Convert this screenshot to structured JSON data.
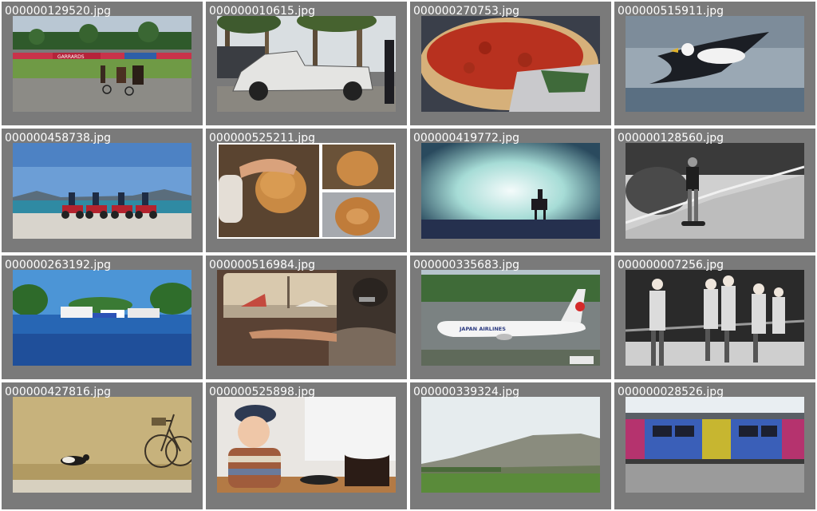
{
  "gallery": {
    "tiles": [
      {
        "filename": "000000129520.jpg",
        "scene": "harness-racing"
      },
      {
        "filename": "000000010615.jpg",
        "scene": "pickup-truck-palms"
      },
      {
        "filename": "000000270753.jpg",
        "scene": "deep-dish-pizza"
      },
      {
        "filename": "000000515911.jpg",
        "scene": "seagull-flight"
      },
      {
        "filename": "000000458738.jpg",
        "scene": "motorcycles-beach"
      },
      {
        "filename": "000000525211.jpg",
        "scene": "donut-collage"
      },
      {
        "filename": "000000419772.jpg",
        "scene": "horse-rider-sky"
      },
      {
        "filename": "000000128560.jpg",
        "scene": "skateboarder-bw"
      },
      {
        "filename": "000000263192.jpg",
        "scene": "marina-boats"
      },
      {
        "filename": "000000516984.jpg",
        "scene": "airport-window-man"
      },
      {
        "filename": "000000335683.jpg",
        "scene": "japan-airlines-plane"
      },
      {
        "filename": "000000007256.jpg",
        "scene": "people-phones-bw"
      },
      {
        "filename": "000000427816.jpg",
        "scene": "cat-bicycle"
      },
      {
        "filename": "000000525898.jpg",
        "scene": "child-cake"
      },
      {
        "filename": "000000339324.jpg",
        "scene": "mesa-landscape"
      },
      {
        "filename": "000000028526.jpg",
        "scene": "train-platform"
      }
    ],
    "airplane_livery": "JAPAN AIRLINES",
    "banner_text": "GARRARDS",
    "colors": {
      "tile_background": "#7a7a7a",
      "filename_text": "#ffffff",
      "page_background": "#ffffff"
    }
  }
}
